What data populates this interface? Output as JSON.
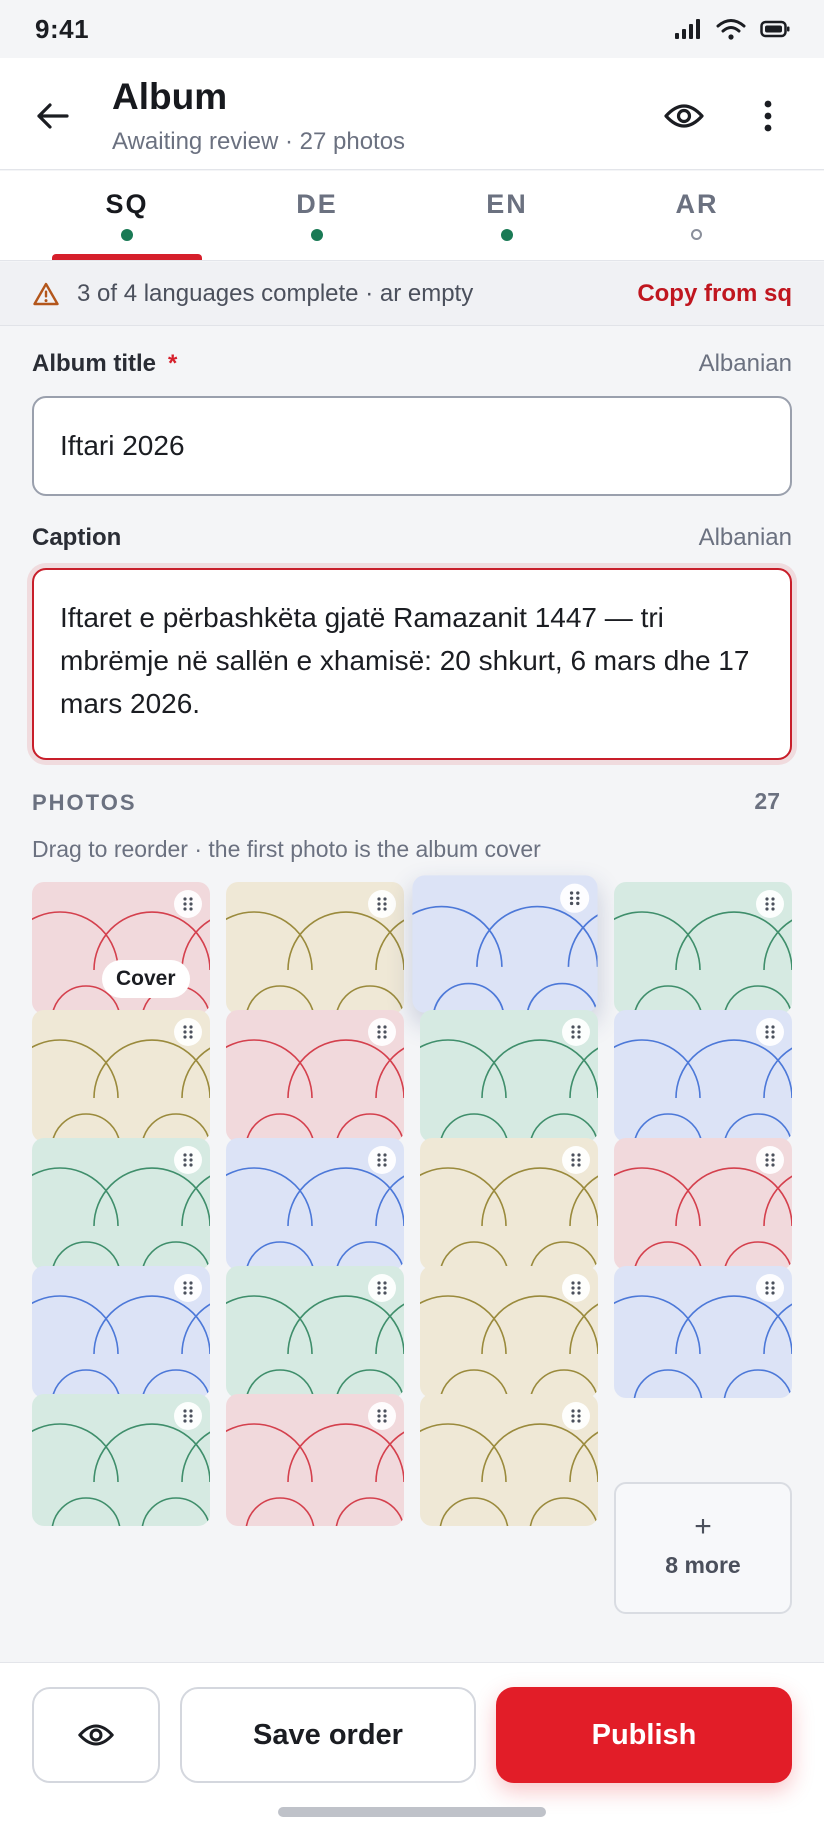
{
  "status_bar": {
    "time": "9:41"
  },
  "header": {
    "title": "Album",
    "subtitle": "Awaiting review · 27 photos"
  },
  "tabs": [
    {
      "label": "SQ",
      "complete": true,
      "active": true
    },
    {
      "label": "DE",
      "complete": true,
      "active": false
    },
    {
      "label": "EN",
      "complete": true,
      "active": false
    },
    {
      "label": "AR",
      "complete": false,
      "active": false
    }
  ],
  "notice": {
    "text": "3 of 4 languages complete · ar empty",
    "action": "Copy from sq"
  },
  "album_title": {
    "label": "Album title",
    "required_mark": "*",
    "language": "Albanian",
    "value": "Iftari 2026"
  },
  "caption": {
    "label": "Caption",
    "language": "Albanian",
    "value": "Iftaret e përbashkëta gjatë Ramazanit 1447 — tri mbrëmje në sallën e xhamisë: 20 shkurt, 6 mars dhe 17 mars 2026."
  },
  "photos": {
    "header": "PHOTOS",
    "count": "27",
    "hint": "Drag to reorder · the first photo is the album cover",
    "cover_label": "Cover",
    "more_label": "8 more",
    "more_plus": "+",
    "tile_colors": [
      "red",
      "yellow",
      "blue",
      "green",
      "yellow",
      "red",
      "green",
      "blue",
      "green",
      "blue",
      "yellow",
      "red",
      "blue",
      "green",
      "yellow",
      "blue",
      "green",
      "red",
      "yellow"
    ]
  },
  "palette": {
    "red": {
      "bg": "#f1d9dc",
      "line": "#d4404d"
    },
    "yellow": {
      "bg": "#efe8d6",
      "line": "#9a8a3c"
    },
    "blue": {
      "bg": "#dce3f6",
      "line": "#4c78d8"
    },
    "green": {
      "bg": "#d6eae2",
      "line": "#3f8e6b"
    },
    "accent": "#e21d28"
  },
  "actions": {
    "save_label": "Save order",
    "publish_label": "Publish"
  }
}
